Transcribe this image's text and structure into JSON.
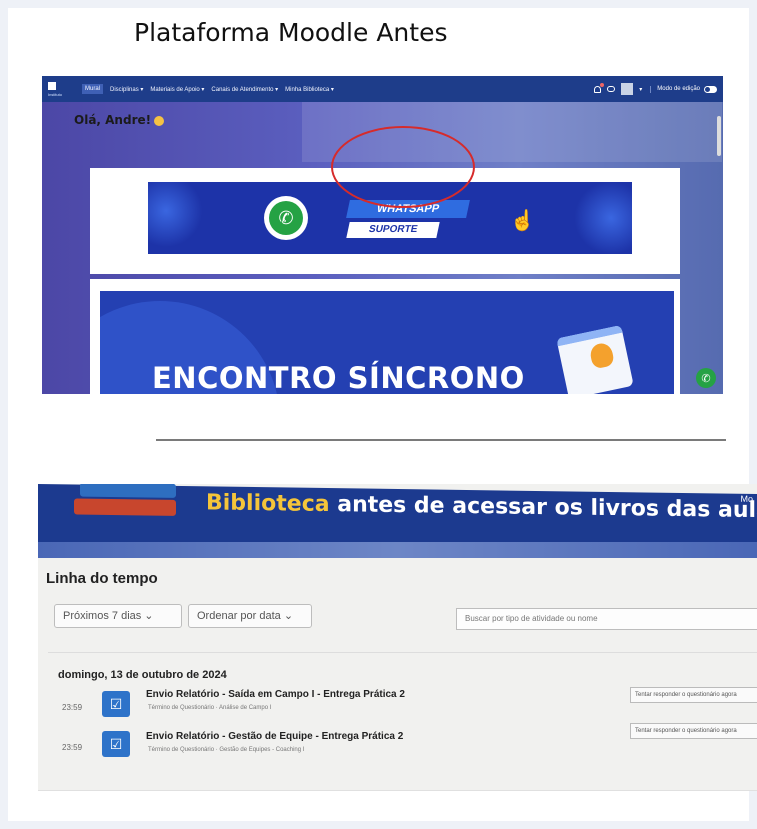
{
  "page_title": "Plataforma Moodle Antes",
  "top_screenshot": {
    "logo_text": "Instituto",
    "nav": [
      "Mural",
      "Disciplinas ▾",
      "Materiais de Apoio ▾",
      "Canais de Atendimento ▾",
      "Minha Biblioteca ▾"
    ],
    "edit_mode_label": "Modo de edição",
    "greeting": "Olá, Andre!",
    "whatsapp_title": "WHATSAPP",
    "whatsapp_subtitle": "SUPORTE",
    "encontro_text": "ENCONTRO SÍNCRONO",
    "annotation_color": "#d62b2b",
    "navbar_color": "#1e3d8a"
  },
  "bottom_screenshot": {
    "banner_highlight": "Biblioteca",
    "banner_rest": " antes de acessar os livros das aulas!",
    "menu_fragment": "Mo",
    "timeline_title": "Linha do tempo",
    "filter_period": "Próximos 7 dias ⌄",
    "filter_sort": "Ordenar por data ⌄",
    "search_placeholder": "Buscar por tipo de atividade ou nome",
    "day_heading": "domingo, 13 de outubro de 2024",
    "events": [
      {
        "time": "23:59",
        "title": "Envio Relatório - Saída em Campo I - Entrega Prática 2",
        "subtitle": "Término de Questionário · Análise de Campo I",
        "action": "Tentar responder o questionário agora"
      },
      {
        "time": "23:59",
        "title": "Envio Relatório - Gestão de Equipe - Entrega Prática 2",
        "subtitle": "Término de Questionário · Gestão de Equipes - Coaching I",
        "action": "Tentar responder o questionário agora"
      }
    ],
    "event_icon_color": "#2e73c9"
  }
}
